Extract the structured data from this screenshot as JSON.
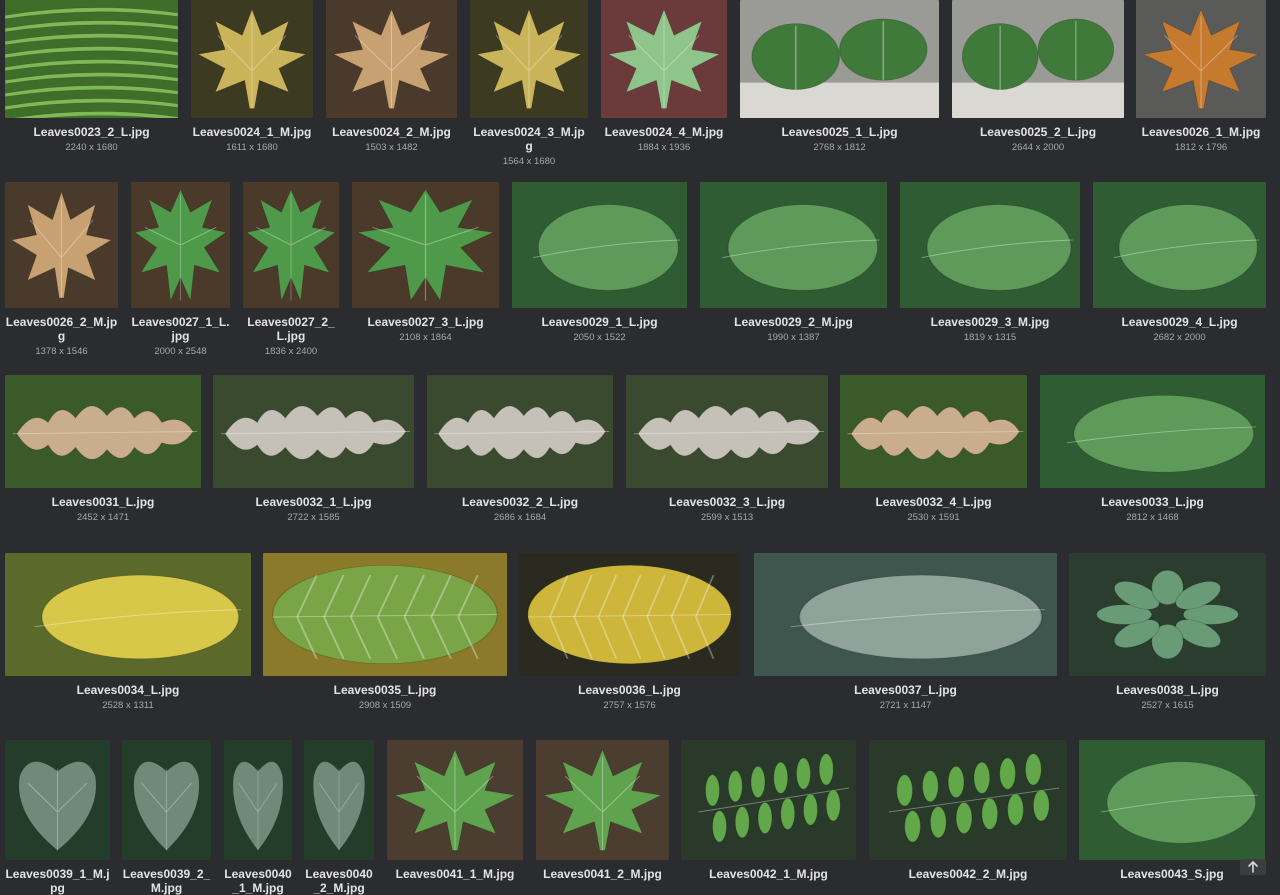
{
  "gallery": {
    "rows": [
      {
        "tiles": [
          {
            "name": "Leaves0023_2_L.jpg",
            "dims": "2240 x 1680",
            "leaf": "fern"
          },
          {
            "name": "Leaves0024_1_M.jpg",
            "dims": "1611 x 1680",
            "leaf": "maple-yellow"
          },
          {
            "name": "Leaves0024_2_M.jpg",
            "dims": "1503 x 1482",
            "leaf": "maple-tan"
          },
          {
            "name": "Leaves0024_3_M.jpg",
            "dims": "1564 x 1680",
            "leaf": "maple-yellow"
          },
          {
            "name": "Leaves0024_4_M.jpg",
            "dims": "1884 x 1936",
            "leaf": "maple-green"
          },
          {
            "name": "Leaves0025_1_L.jpg",
            "dims": "2768 x 1812",
            "leaf": "round-pair"
          },
          {
            "name": "Leaves0025_2_L.jpg",
            "dims": "2644 x 2000",
            "leaf": "round-pair"
          },
          {
            "name": "Leaves0026_1_M.jpg",
            "dims": "1812 x 1796",
            "leaf": "maple-orange"
          }
        ]
      },
      {
        "tiles": [
          {
            "name": "Leaves0026_2_M.jpg",
            "dims": "1378 x 1546",
            "leaf": "maple-tan"
          },
          {
            "name": "Leaves0027_1_L.jpg",
            "dims": "2000 x 2548",
            "leaf": "cut-green"
          },
          {
            "name": "Leaves0027_2_L.jpg",
            "dims": "1836 x 2400",
            "leaf": "cut-green"
          },
          {
            "name": "Leaves0027_3_L.jpg",
            "dims": "2108 x 1864",
            "leaf": "cut-green"
          },
          {
            "name": "Leaves0029_1_L.jpg",
            "dims": "2050 x 1522",
            "leaf": "oval-green"
          },
          {
            "name": "Leaves0029_2_M.jpg",
            "dims": "1990 x 1387",
            "leaf": "oval-green"
          },
          {
            "name": "Leaves0029_3_M.jpg",
            "dims": "1819 x 1315",
            "leaf": "oval-green"
          },
          {
            "name": "Leaves0029_4_L.jpg",
            "dims": "2682 x 2000",
            "leaf": "oval-green"
          }
        ]
      },
      {
        "tiles": [
          {
            "name": "Leaves0031_L.jpg",
            "dims": "2452 x 1471",
            "leaf": "oak-tan"
          },
          {
            "name": "Leaves0032_1_L.jpg",
            "dims": "2722 x 1585",
            "leaf": "oak-pale"
          },
          {
            "name": "Leaves0032_2_L.jpg",
            "dims": "2686 x 1684",
            "leaf": "oak-pale"
          },
          {
            "name": "Leaves0032_3_L.jpg",
            "dims": "2599 x 1513",
            "leaf": "oak-pale"
          },
          {
            "name": "Leaves0032_4_L.jpg",
            "dims": "2530 x 1591",
            "leaf": "oak-tan"
          },
          {
            "name": "Leaves0033_L.jpg",
            "dims": "2812 x 1468",
            "leaf": "oval-green"
          }
        ]
      },
      {
        "tiles": [
          {
            "name": "Leaves0034_L.jpg",
            "dims": "2528 x 1311",
            "leaf": "oval-yellow"
          },
          {
            "name": "Leaves0035_L.jpg",
            "dims": "2908 x 1509",
            "leaf": "veined-green"
          },
          {
            "name": "Leaves0036_L.jpg",
            "dims": "2757 x 1576",
            "leaf": "veined-yellow"
          },
          {
            "name": "Leaves0037_L.jpg",
            "dims": "2721 x 1147",
            "leaf": "oval-grey"
          },
          {
            "name": "Leaves0038_L.jpg",
            "dims": "2527 x 1615",
            "leaf": "rosette"
          }
        ]
      },
      {
        "tiles": [
          {
            "name": "Leaves0039_1_M.jpg",
            "dims": "",
            "leaf": "heart-dark"
          },
          {
            "name": "Leaves0039_2_M.jpg",
            "dims": "",
            "leaf": "heart-dark"
          },
          {
            "name": "Leaves0040_1_M.jpg",
            "dims": "",
            "leaf": "heart-dark"
          },
          {
            "name": "Leaves0040_2_M.jpg",
            "dims": "",
            "leaf": "heart-dark"
          },
          {
            "name": "Leaves0041_1_M.jpg",
            "dims": "",
            "leaf": "fig"
          },
          {
            "name": "Leaves0041_2_M.jpg",
            "dims": "",
            "leaf": "fig"
          },
          {
            "name": "Leaves0042_1_M.jpg",
            "dims": "",
            "leaf": "pinnate"
          },
          {
            "name": "Leaves0042_2_M.jpg",
            "dims": "",
            "leaf": "pinnate"
          },
          {
            "name": "Leaves0043_S.jpg",
            "dims": "",
            "leaf": "oval-green"
          }
        ]
      }
    ]
  },
  "controls": {
    "scroll_top_icon": "arrow-up-icon"
  }
}
